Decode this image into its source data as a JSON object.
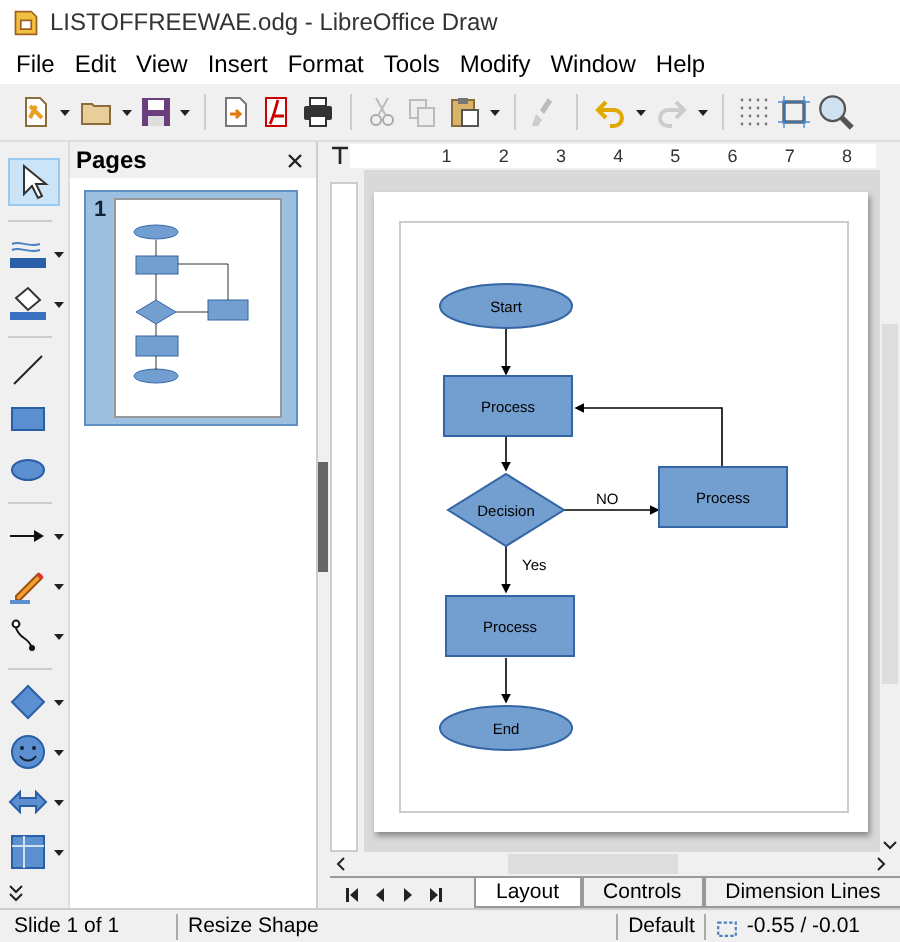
{
  "window": {
    "title": "LISTOFFREEWAE.odg - LibreOffice Draw"
  },
  "menu": [
    "File",
    "Edit",
    "View",
    "Insert",
    "Format",
    "Tools",
    "Modify",
    "Window",
    "Help"
  ],
  "pages_panel": {
    "title": "Pages",
    "thumbnails": [
      {
        "number": "1",
        "selected": true
      }
    ]
  },
  "ruler": {
    "numbers": [
      "1",
      "2",
      "3",
      "4",
      "5",
      "6",
      "7",
      "8"
    ]
  },
  "diagram": {
    "nodes": [
      {
        "kind": "terminal",
        "label": "Start"
      },
      {
        "kind": "process",
        "label": "Process"
      },
      {
        "kind": "decision",
        "label": "Decision"
      },
      {
        "kind": "process",
        "label": "Process"
      },
      {
        "kind": "process",
        "label": "Process"
      },
      {
        "kind": "terminal",
        "label": "End"
      }
    ],
    "edge_labels": [
      "NO",
      "Yes"
    ]
  },
  "tabs": [
    {
      "label": "Layout",
      "selected": true
    },
    {
      "label": "Controls",
      "selected": false
    },
    {
      "label": "Dimension Lines",
      "selected": false
    }
  ],
  "status_bar": {
    "slide": "Slide 1 of 1",
    "action": "Resize Shape",
    "style": "Default",
    "position": "-0.55 / -0.01"
  }
}
